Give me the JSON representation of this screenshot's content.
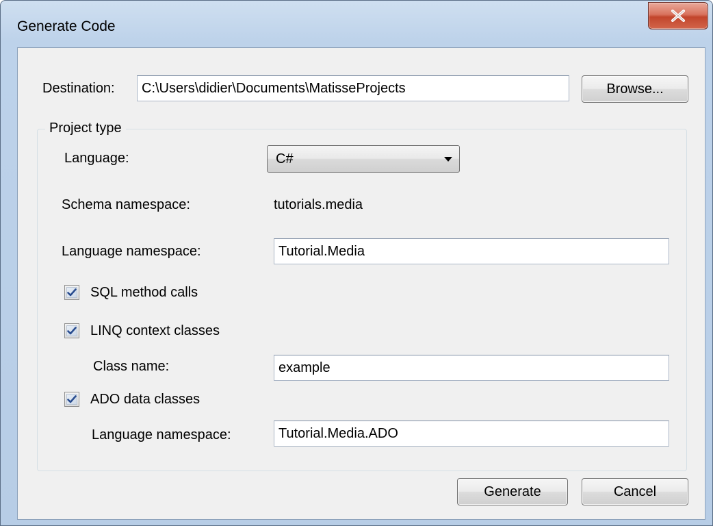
{
  "window": {
    "title": "Generate Code",
    "close_glyph": "X"
  },
  "destination": {
    "label": "Destination:",
    "value": "C:\\Users\\didier\\Documents\\MatisseProjects",
    "browse_label": "Browse..."
  },
  "project_type": {
    "legend": "Project type",
    "language_label": "Language:",
    "language_value": "C#",
    "schema_namespace_label": "Schema namespace:",
    "schema_namespace_value": "tutorials.media",
    "language_namespace_label": "Language namespace:",
    "language_namespace_value": "Tutorial.Media",
    "sql_method_calls_label": "SQL method calls",
    "sql_method_calls_checked": true,
    "linq_context_label": "LINQ context classes",
    "linq_context_checked": true,
    "class_name_label": "Class name:",
    "class_name_value": "example",
    "ado_data_label": "ADO data classes",
    "ado_data_checked": true,
    "ado_namespace_label": "Language namespace:",
    "ado_namespace_value": "Tutorial.Media.ADO"
  },
  "footer": {
    "generate_label": "Generate",
    "cancel_label": "Cancel"
  },
  "colors": {
    "check_mark": "#2a4d8f",
    "close_button": "#c2452c"
  }
}
